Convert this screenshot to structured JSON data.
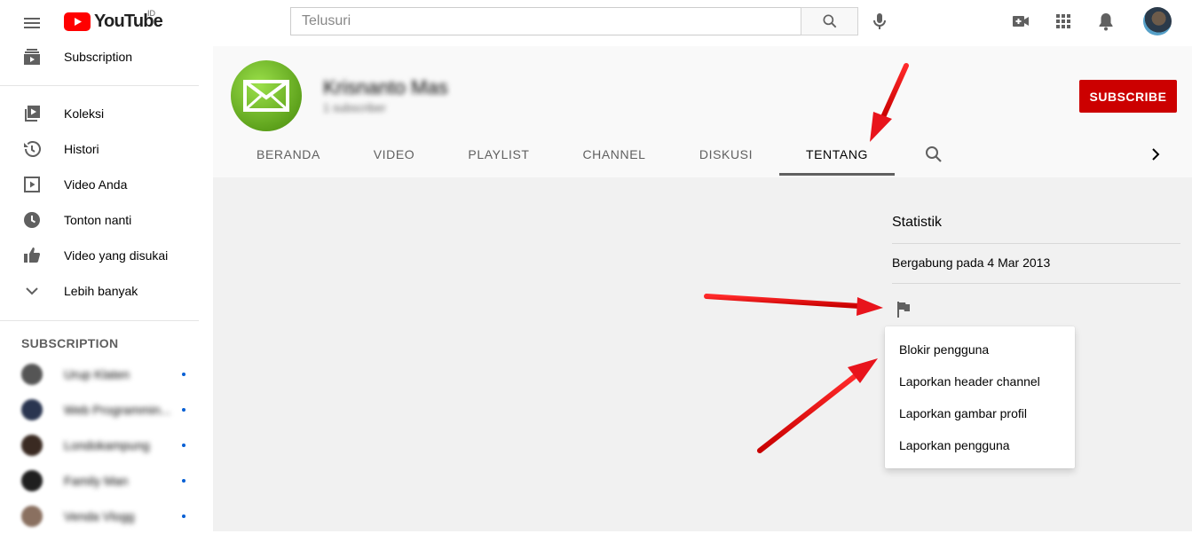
{
  "topbar": {
    "logo_text": "YouTube",
    "country_code": "ID",
    "search_placeholder": "Telusuri"
  },
  "sidebar": {
    "top_item": {
      "label": "Subscription",
      "icon": "subscriptions-icon"
    },
    "library_items": [
      {
        "label": "Koleksi",
        "icon": "library-icon"
      },
      {
        "label": "Histori",
        "icon": "history-icon"
      },
      {
        "label": "Video Anda",
        "icon": "your-videos-icon"
      },
      {
        "label": "Tonton nanti",
        "icon": "watch-later-icon"
      },
      {
        "label": "Video yang disukai",
        "icon": "liked-icon"
      },
      {
        "label": "Lebih banyak",
        "icon": "chevron-down-icon"
      }
    ],
    "subscriptions_heading": "SUBSCRIPTION",
    "subscriptions": [
      {
        "name": "Urup Klaten"
      },
      {
        "name": "Web Programmin..."
      },
      {
        "name": "Londokampung"
      },
      {
        "name": "Family Man"
      },
      {
        "name": "Venda Vlogg"
      }
    ]
  },
  "channel": {
    "name": "Krisnanto Mas",
    "subscribers": "1 subscriber",
    "subscribe_label": "SUBSCRIBE",
    "tabs": [
      "BERANDA",
      "VIDEO",
      "PLAYLIST",
      "CHANNEL",
      "DISKUSI",
      "TENTANG"
    ],
    "active_tab": "TENTANG"
  },
  "about": {
    "stats_title": "Statistik",
    "joined": "Bergabung pada 4 Mar 2013"
  },
  "report_menu": {
    "items": [
      "Blokir pengguna",
      "Laporkan header channel",
      "Laporkan gambar profil",
      "Laporkan pengguna"
    ]
  },
  "colors": {
    "brand_red": "#ff0000",
    "subscribe_red": "#cc0000",
    "annotation_arrow": "#e8141c"
  }
}
